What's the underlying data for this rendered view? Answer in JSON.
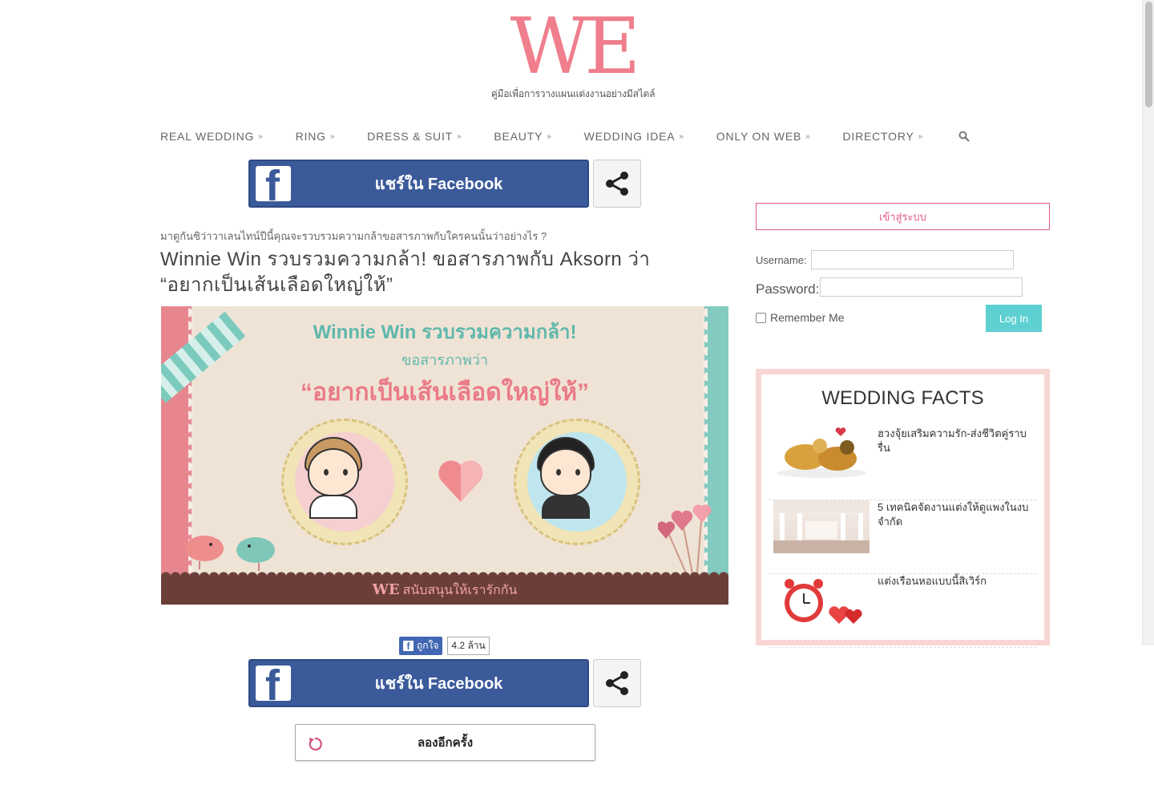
{
  "logo": {
    "mark": "WE",
    "tagline": "คู่มือเพื่อการวางแผนแต่งงานอย่างมีสไตล์"
  },
  "nav": {
    "items": [
      {
        "label": "REAL WEDDING"
      },
      {
        "label": "RING"
      },
      {
        "label": "DRESS & SUIT"
      },
      {
        "label": "BEAUTY"
      },
      {
        "label": "WEDDING IDEA"
      },
      {
        "label": "ONLY ON WEB"
      },
      {
        "label": "DIRECTORY"
      }
    ],
    "search_icon": "search-icon"
  },
  "share": {
    "facebook_label": "แชร์ใน Facebook",
    "share_icon": "share-icon"
  },
  "article": {
    "kicker": "มาดูกันซิว่าวาเลนไทน์ปีนี้คุณจะรวบรวมความกล้าขอสารภาพกับใครคนนั้นว่าอย่างไร ?",
    "headline": "Winnie Win รวบรวมความกล้า! ขอสารภาพกับ Aksorn ว่า “อยากเป็นเส้นเลือดใหญ่ให้”",
    "hero": {
      "line1": "Winnie Win รวบรวมความกล้า!",
      "line2": "ขอสารภาพว่า",
      "line3": "“อยากเป็นเส้นเลือดใหญ่ให้”",
      "footer_brand": "WE",
      "footer_text": "สนับสนุนให้เรารักกัน"
    }
  },
  "like": {
    "label": "ถูกใจ",
    "count": "4.2 ล้าน"
  },
  "retry": {
    "label": "ลองอีกครั้ง"
  },
  "login": {
    "title": "เข้าสู่ระบบ",
    "username_label": "Username:",
    "password_label": "Password:",
    "username_value": "",
    "password_value": "",
    "remember_label": "Remember Me",
    "button_label": "Log In"
  },
  "facts": {
    "heading": "WEDDING FACTS",
    "items": [
      {
        "title": "ฮวงจุ้ยเสริมความรัก-ส่งชีวิตคู่ราบรื่น"
      },
      {
        "title": "5 เทคนิคจัดงานแต่งให้ดูแพงในงบจำกัด"
      },
      {
        "title": "แต่งเรือนหอแบบนี้สิเวิร์ก"
      }
    ]
  },
  "colors": {
    "brand_pink": "#f07e8c",
    "facebook_blue": "#3b5a9a",
    "teal": "#5ed0d2",
    "login_pink": "#e25a8a"
  }
}
